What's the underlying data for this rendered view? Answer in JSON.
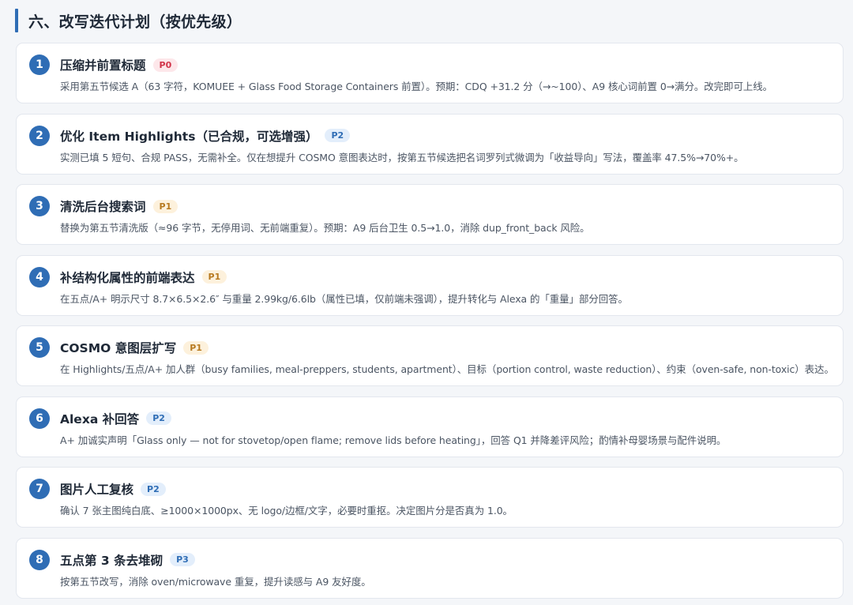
{
  "section": {
    "title": "六、改写迭代计划（按优先级）"
  },
  "colors": {
    "accent": "#2f6db5",
    "p0": "#d1344a",
    "p1": "#b7791f",
    "p2": "#2f6db5"
  },
  "items": [
    {
      "num": "1",
      "title": "压缩并前置标题",
      "priority": "P0",
      "desc": "采用第五节候选 A（63 字符，KOMUEE + Glass Food Storage Containers 前置）。预期：CDQ +31.2 分（→~100）、A9 核心词前置 0→满分。改完即可上线。"
    },
    {
      "num": "2",
      "title": "优化 Item Highlights（已合规，可选增强）",
      "priority": "P2",
      "desc": "实测已填 5 短句、合规 PASS，无需补全。仅在想提升 COSMO 意图表达时，按第五节候选把名词罗列式微调为「收益导向」写法，覆盖率 47.5%→70%+。"
    },
    {
      "num": "3",
      "title": "清洗后台搜索词",
      "priority": "P1",
      "desc": "替换为第五节清洗版（≈96 字节，无停用词、无前端重复）。预期：A9 后台卫生 0.5→1.0，消除 dup_front_back 风险。"
    },
    {
      "num": "4",
      "title": "补结构化属性的前端表达",
      "priority": "P1",
      "desc": "在五点/A+ 明示尺寸 8.7×6.5×2.6″ 与重量 2.99kg/6.6lb（属性已填，仅前端未强调），提升转化与 Alexa 的「重量」部分回答。"
    },
    {
      "num": "5",
      "title": "COSMO 意图层扩写",
      "priority": "P1",
      "desc": "在 Highlights/五点/A+ 加人群（busy families, meal-preppers, students, apartment）、目标（portion control, waste reduction）、约束（oven-safe, non-toxic）表达。"
    },
    {
      "num": "6",
      "title": "Alexa 补回答",
      "priority": "P2",
      "desc": "A+ 加诚实声明「Glass only — not for stovetop/open flame; remove lids before heating」，回答 Q1 并降差评风险；酌情补母婴场景与配件说明。"
    },
    {
      "num": "7",
      "title": "图片人工复核",
      "priority": "P2",
      "desc": "确认 7 张主图纯白底、≥1000×1000px、无 logo/边框/文字，必要时重抠。决定图片分是否真为 1.0。"
    },
    {
      "num": "8",
      "title": "五点第 3 条去堆砌",
      "priority": "P3",
      "desc": "按第五节改写，消除 oven/microwave 重复，提升读感与 A9 友好度。"
    }
  ]
}
